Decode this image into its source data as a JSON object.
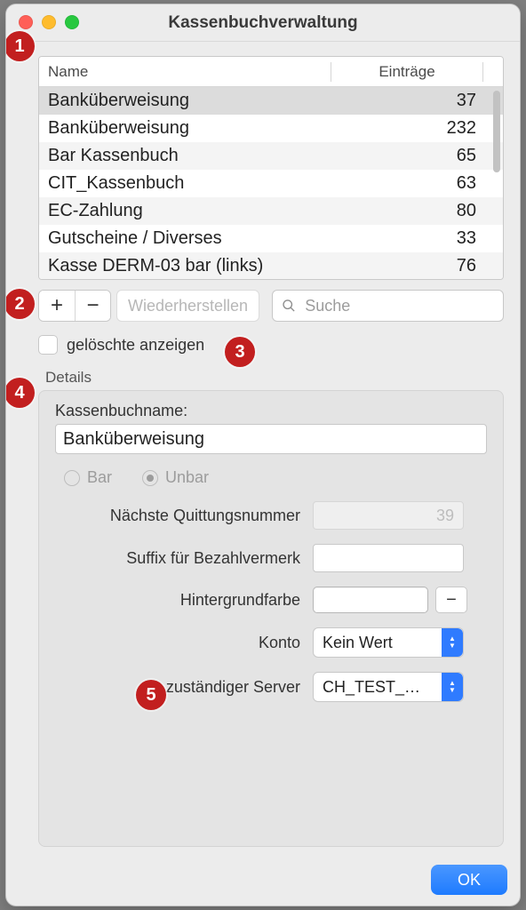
{
  "window": {
    "title": "Kassenbuchverwaltung"
  },
  "table": {
    "header_name": "Name",
    "header_entries": "Einträge",
    "rows": [
      {
        "name": "Banküberweisung",
        "entries": "37",
        "selected": true
      },
      {
        "name": "Banküberweisung",
        "entries": "232"
      },
      {
        "name": "Bar Kassenbuch",
        "entries": "65"
      },
      {
        "name": "CIT_Kassenbuch",
        "entries": "63"
      },
      {
        "name": "EC-Zahlung",
        "entries": "80"
      },
      {
        "name": "Gutscheine / Diverses",
        "entries": "33"
      },
      {
        "name": "Kasse DERM-03 bar (links)",
        "entries": "76"
      }
    ]
  },
  "toolbar": {
    "add_label": "+",
    "remove_label": "−",
    "restore_label": "Wiederherstellen",
    "search_placeholder": "Suche"
  },
  "show_deleted": {
    "label": "gelöschte anzeigen",
    "checked": false
  },
  "details": {
    "group_label": "Details",
    "name_label": "Kassenbuchname:",
    "name_value": "Banküberweisung",
    "radio_bar": "Bar",
    "radio_unbar": "Unbar",
    "radio_selected": "unbar",
    "next_number_label": "Nächste Quittungsnummer",
    "next_number_value": "39",
    "suffix_label": "Suffix für Bezahlvermerk",
    "suffix_value": "",
    "bg_color_label": "Hintergrundfarbe",
    "minus_label": "−",
    "konto_label": "Konto",
    "konto_value": "Kein Wert",
    "server_label": "zuständiger Server",
    "server_value": "CH_TEST_…"
  },
  "footer": {
    "ok_label": "OK"
  },
  "annotations": {
    "b1": "1",
    "b2": "2",
    "b3": "3",
    "b4": "4",
    "b5": "5"
  }
}
